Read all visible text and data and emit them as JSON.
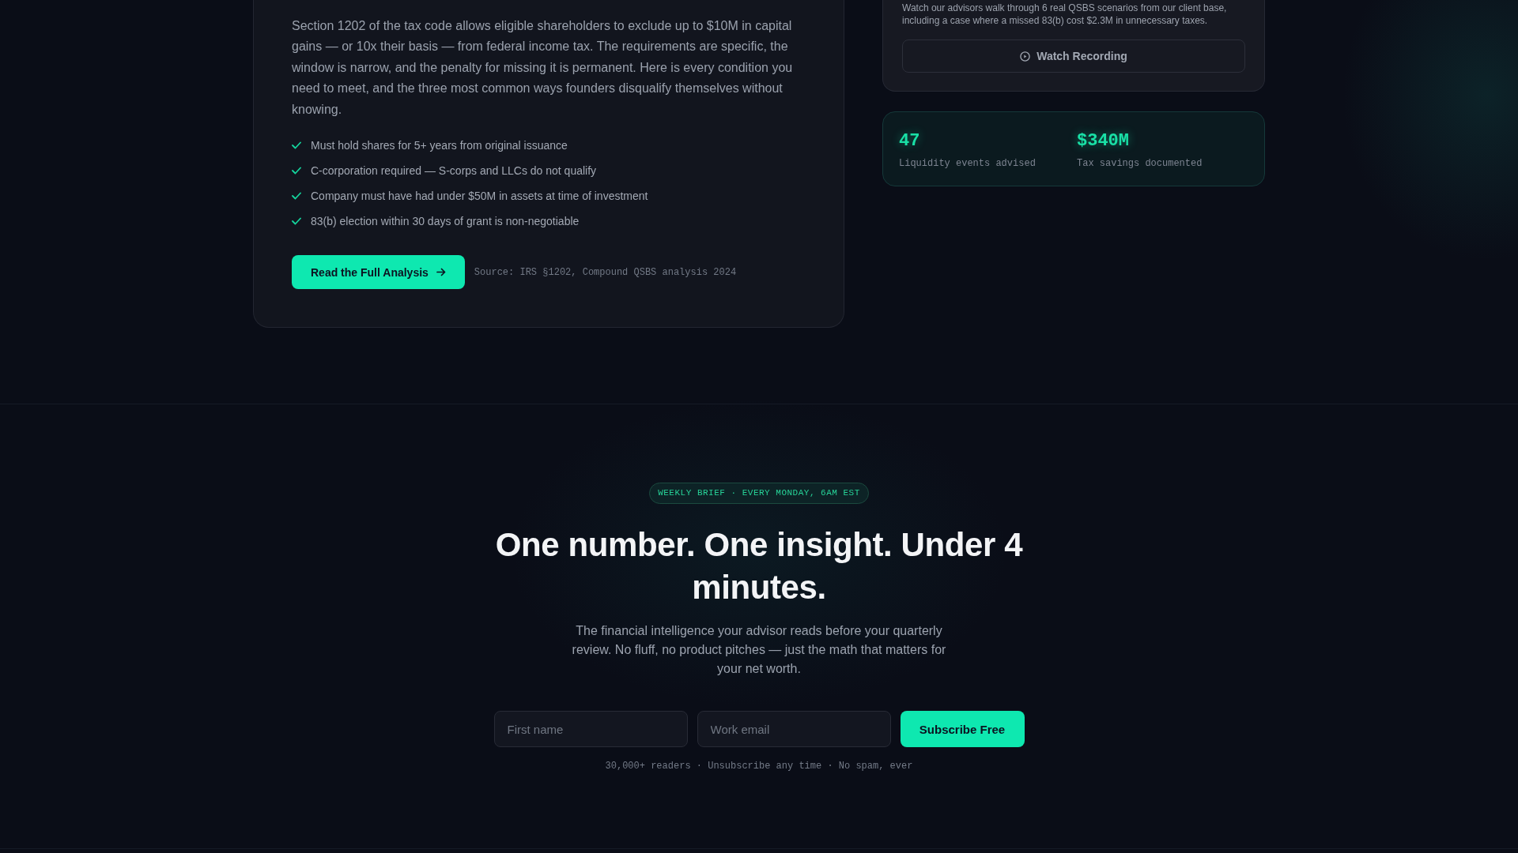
{
  "article_card": {
    "body": "Section 1202 of the tax code allows eligible shareholders to exclude up to $10M in capital gains — or 10x their basis — from federal income tax. The requirements are specific, the window is narrow, and the penalty for missing it is permanent. Here is every condition you need to meet, and the three most common ways founders disqualify themselves without knowing.",
    "requirements": [
      "Must hold shares for 5+ years from original issuance",
      "C-corporation required — S-corps and LLCs do not qualify",
      "Company must have had under $50M in assets at time of investment",
      "83(b) election within 30 days of grant is non-negotiable"
    ],
    "cta": "Read the Full Analysis",
    "source": "Source: IRS §1202, Compound QSBS analysis 2024"
  },
  "webinar_card": {
    "description": "Watch our advisors walk through 6 real QSBS scenarios from our client base, including a case where a missed 83(b) cost $2.3M in unnecessary taxes.",
    "button": "Watch Recording"
  },
  "stats": [
    {
      "value": "47",
      "label": "Liquidity events advised"
    },
    {
      "value": "$340M",
      "label": "Tax savings documented"
    }
  ],
  "newsletter": {
    "badge": "WEEKLY BRIEF · EVERY MONDAY, 6AM EST",
    "heading": "One number. One insight. Under 4 minutes.",
    "description": "The financial intelligence your advisor reads before your quarterly review. No fluff, no product pitches — just the math that matters for your net worth.",
    "fields": [
      {
        "placeholder": "First name"
      },
      {
        "placeholder": "Work email"
      }
    ],
    "submit": "Subscribe Free",
    "footnote": "30,000+ readers · Unsubscribe any time · No spam, ever"
  }
}
